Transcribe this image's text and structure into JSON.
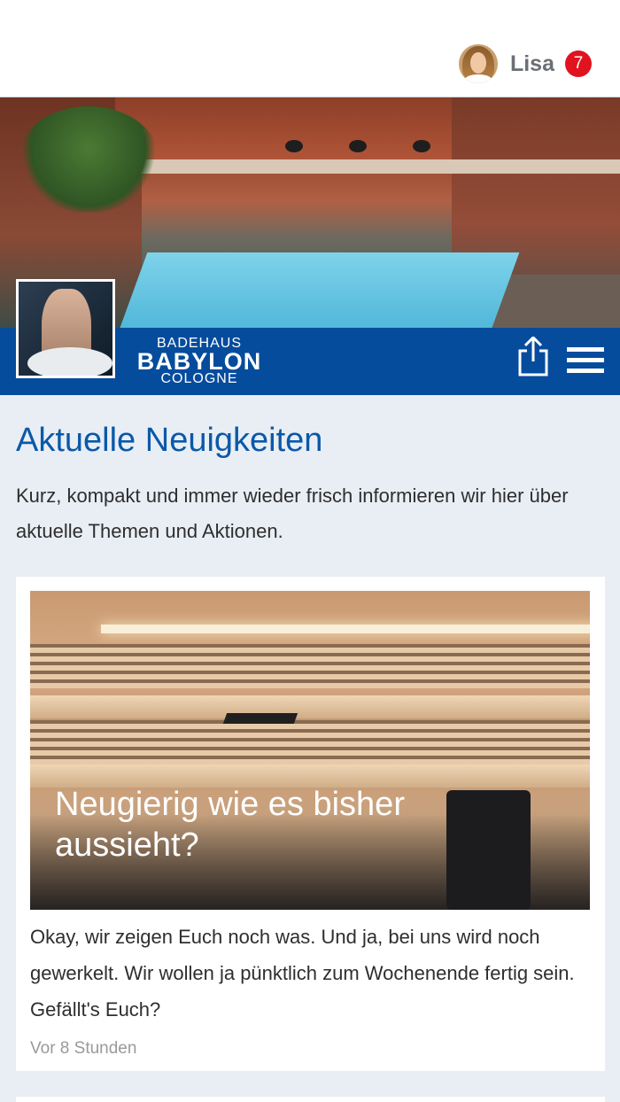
{
  "header": {
    "username": "Lisa",
    "notification_count": "7",
    "avatar_icon": "user-avatar-photo"
  },
  "brand": {
    "logo_line1": "BADEHAUS",
    "logo_line2": "BABYLON",
    "logo_line3": "COLOGNE",
    "share_icon": "share-icon",
    "menu_icon": "hamburger-menu-icon",
    "bar_color": "#064c9d"
  },
  "main": {
    "title": "Aktuelle Neuigkeiten",
    "intro": "Kurz, kompakt und immer wieder frisch informieren wir hier über aktuelle Themen und Aktionen.",
    "posts": [
      {
        "title": "Neugierig wie es bisher aussieht?",
        "text": "Okay, wir zeigen Euch noch was. Und ja, bei uns wird noch gewerkelt. Wir wollen ja pünktlich zum Wochenende fertig sein. Gefällt's Euch?",
        "time": "Vor 8 Stunden"
      }
    ]
  },
  "colors": {
    "accent": "#0a59a8",
    "badge": "#e0131f",
    "background": "#e9eef5"
  }
}
